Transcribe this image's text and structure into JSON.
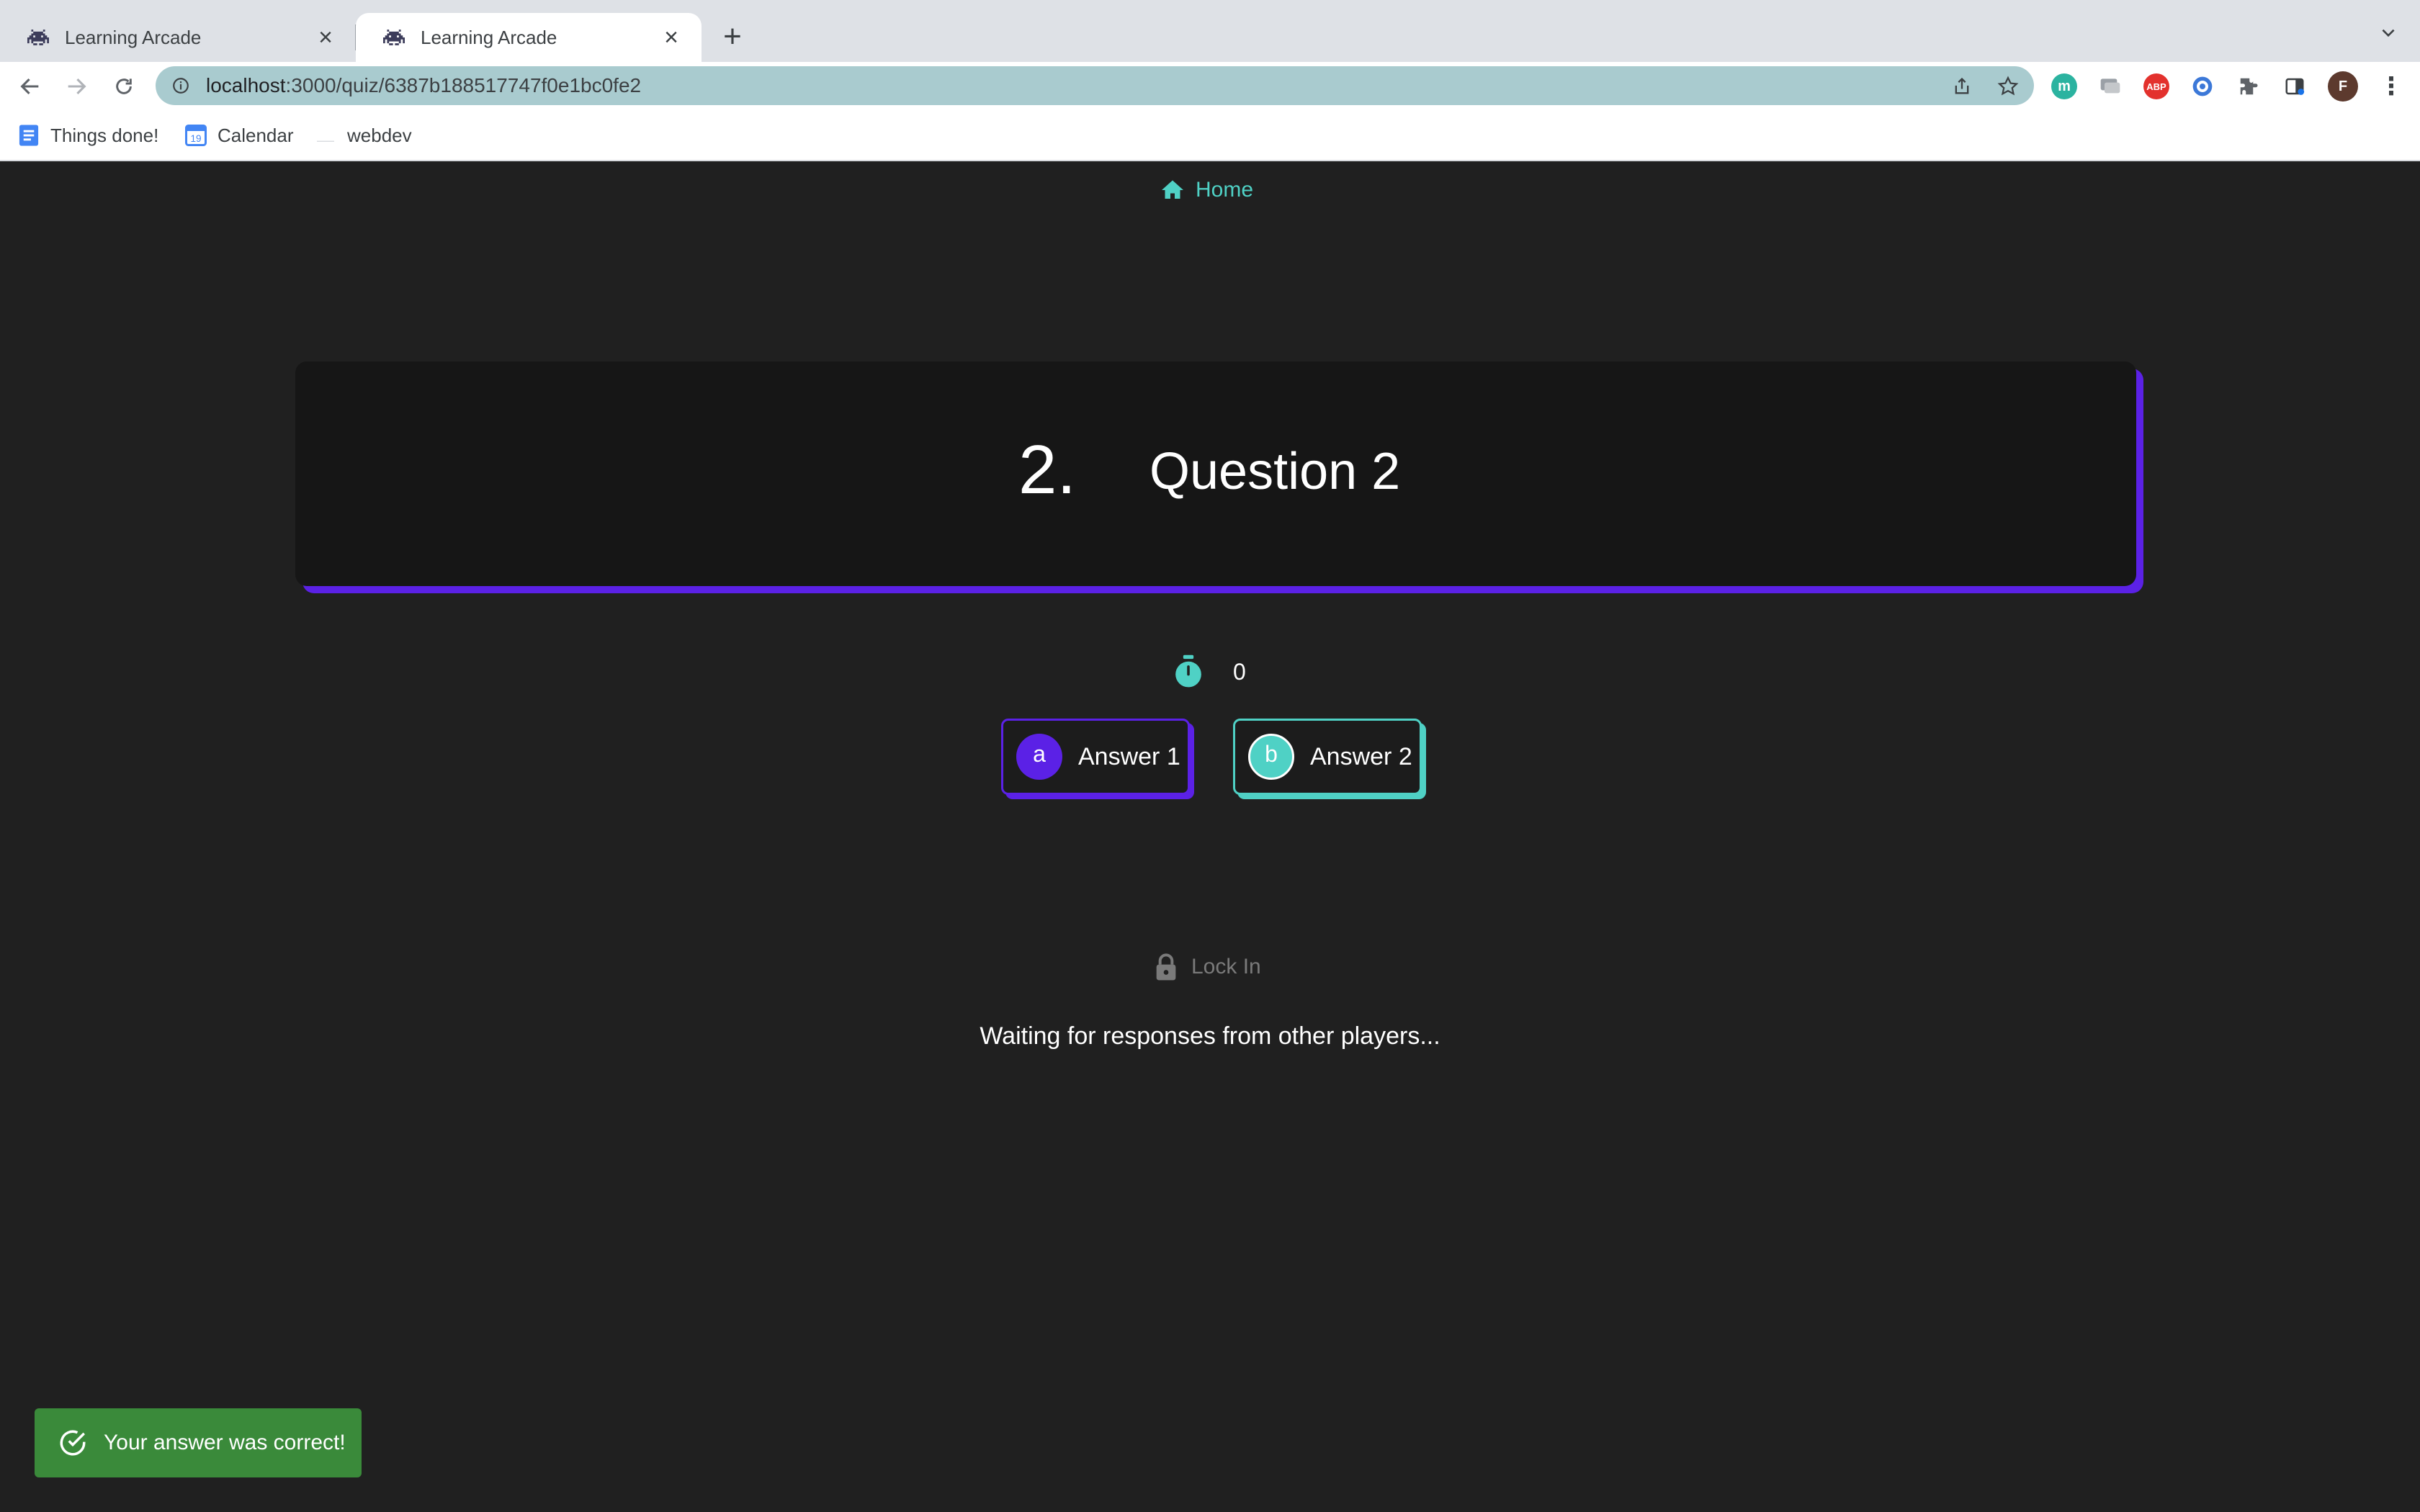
{
  "browser": {
    "tabs": [
      {
        "title": "Learning Arcade",
        "active": false
      },
      {
        "title": "Learning Arcade",
        "active": true
      }
    ],
    "url_host": "localhost",
    "url_path": ":3000/quiz/6387b188517747f0e1bc0fe2",
    "bookmarks": [
      {
        "label": "Things done!",
        "icon": "docs-icon"
      },
      {
        "label": "Calendar",
        "icon": "calendar-icon"
      },
      {
        "label": "webdev",
        "icon": "folder-icon"
      }
    ],
    "extensions": [
      {
        "name": "m-extension-icon",
        "glyph": "m",
        "color": "#2bb3a0"
      },
      {
        "name": "chat-extension-icon",
        "glyph": "",
        "color": "#9aa0a6"
      },
      {
        "name": "adblock-icon",
        "glyph": "ABP",
        "color": "#e3312d"
      },
      {
        "name": "blue-extension-icon",
        "glyph": "",
        "color": "#3c78d8"
      }
    ],
    "profile_initial": "F"
  },
  "nav": {
    "home_label": "Home"
  },
  "question": {
    "number": "2.",
    "text": "Question 2"
  },
  "timer": {
    "value": "0"
  },
  "answers": [
    {
      "letter": "a",
      "label": "Answer 1"
    },
    {
      "letter": "b",
      "label": "Answer 2"
    }
  ],
  "lock_in_label": "Lock In",
  "status_message": "Waiting for responses from other players...",
  "toast": {
    "message": "Your answer was correct!"
  },
  "colors": {
    "accent_purple": "#5b21e6",
    "accent_teal": "#4fd1c5",
    "success_green": "#3a8a3a",
    "background": "#202020"
  }
}
